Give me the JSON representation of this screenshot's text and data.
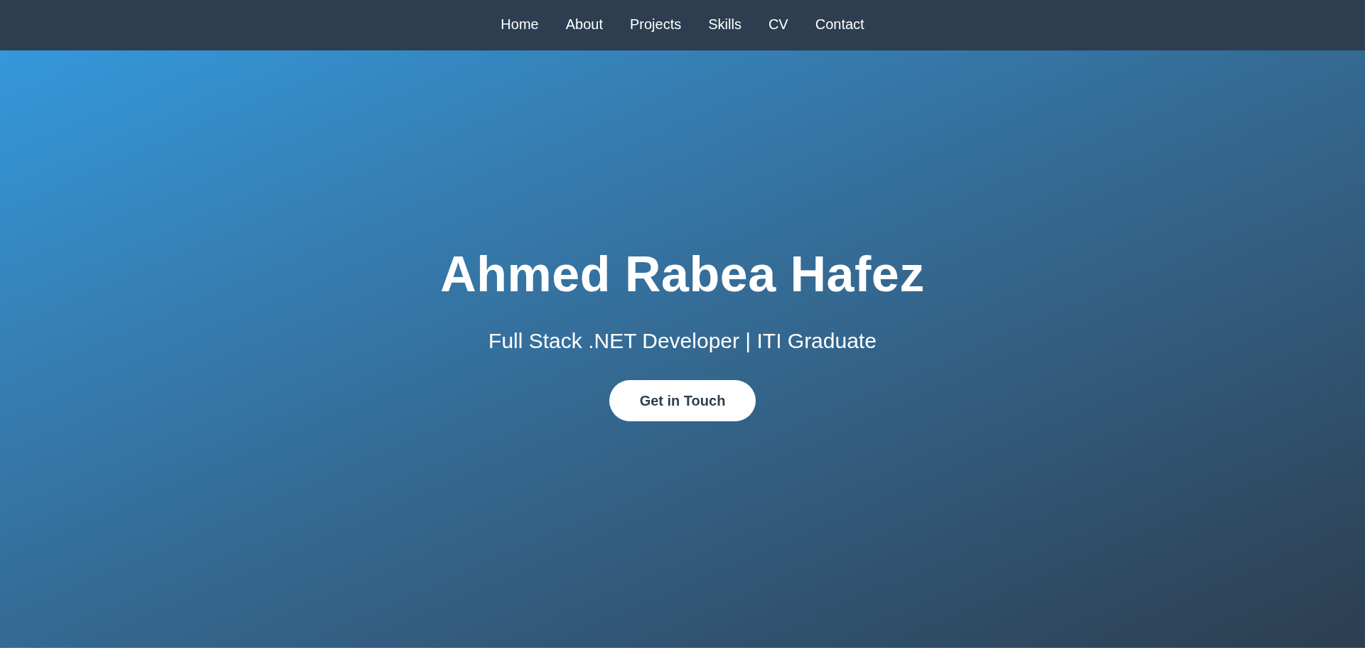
{
  "nav": {
    "items": [
      {
        "label": "Home"
      },
      {
        "label": "About"
      },
      {
        "label": "Projects"
      },
      {
        "label": "Skills"
      },
      {
        "label": "CV"
      },
      {
        "label": "Contact"
      }
    ]
  },
  "hero": {
    "title": "Ahmed Rabea Hafez",
    "subtitle": "Full Stack .NET Developer | ITI Graduate",
    "button": {
      "label": "Get in Touch"
    }
  }
}
